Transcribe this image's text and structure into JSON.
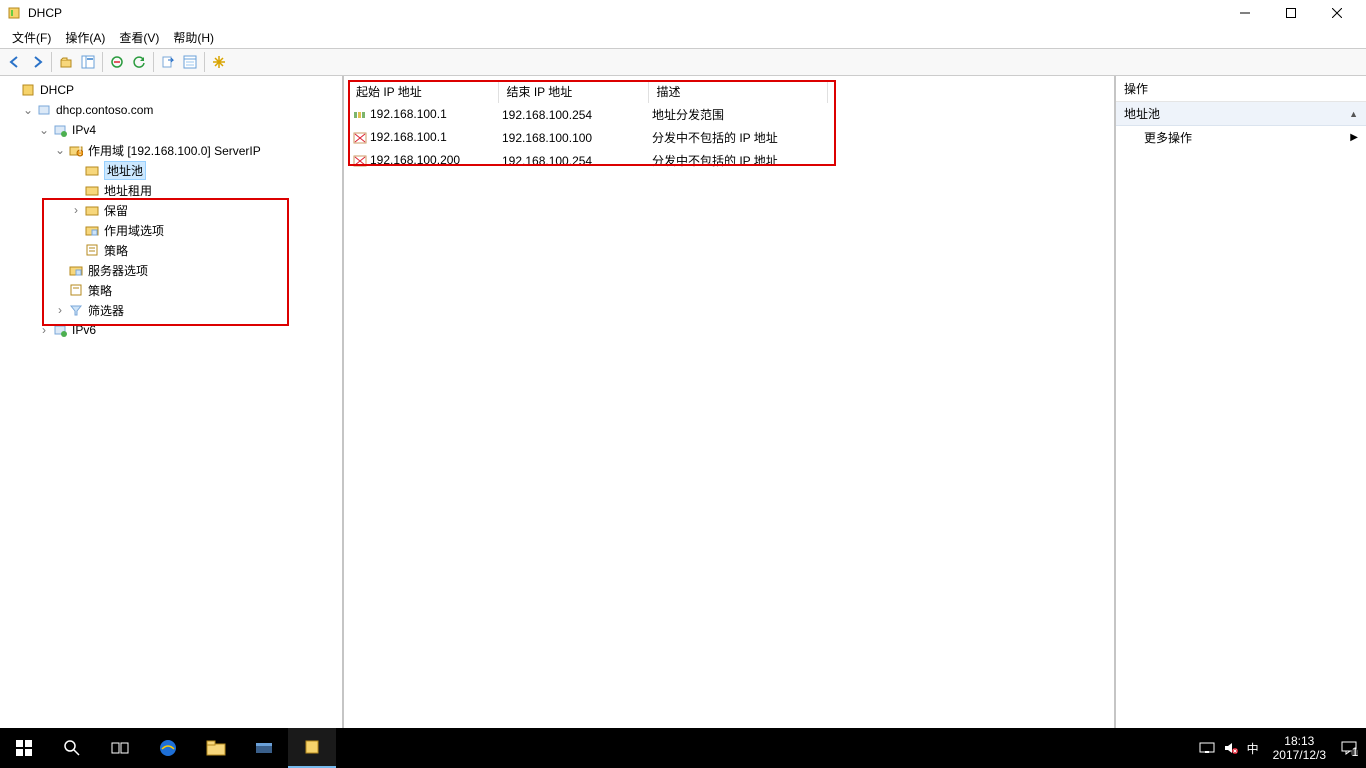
{
  "title": "DHCP",
  "menu": {
    "file": "文件(F)",
    "action": "操作(A)",
    "view": "查看(V)",
    "help": "帮助(H)"
  },
  "tree": {
    "root": "DHCP",
    "server": "dhcp.contoso.com",
    "ipv4": "IPv4",
    "scope": "作用域 [192.168.100.0] ServerIP",
    "pool": "地址池",
    "leases": "地址租用",
    "reservations": "保留",
    "scopeopts": "作用域选项",
    "policies": "策略",
    "serveropts": "服务器选项",
    "srvpolicies": "策略",
    "filters": "筛选器",
    "ipv6": "IPv6"
  },
  "columns": {
    "start": "起始 IP 地址",
    "end": "结束 IP 地址",
    "desc": "描述"
  },
  "rows": [
    {
      "start": "192.168.100.1",
      "end": "192.168.100.254",
      "desc": "地址分发范围",
      "type": "range"
    },
    {
      "start": "192.168.100.1",
      "end": "192.168.100.100",
      "desc": "分发中不包括的 IP 地址",
      "type": "excl"
    },
    {
      "start": "192.168.100.200",
      "end": "192.168.100.254",
      "desc": "分发中不包括的 IP 地址",
      "type": "excl"
    }
  ],
  "actions": {
    "header": "操作",
    "group": "地址池",
    "more": "更多操作"
  },
  "tray": {
    "time": "18:13",
    "date": "2017/12/3",
    "ime": "中"
  }
}
